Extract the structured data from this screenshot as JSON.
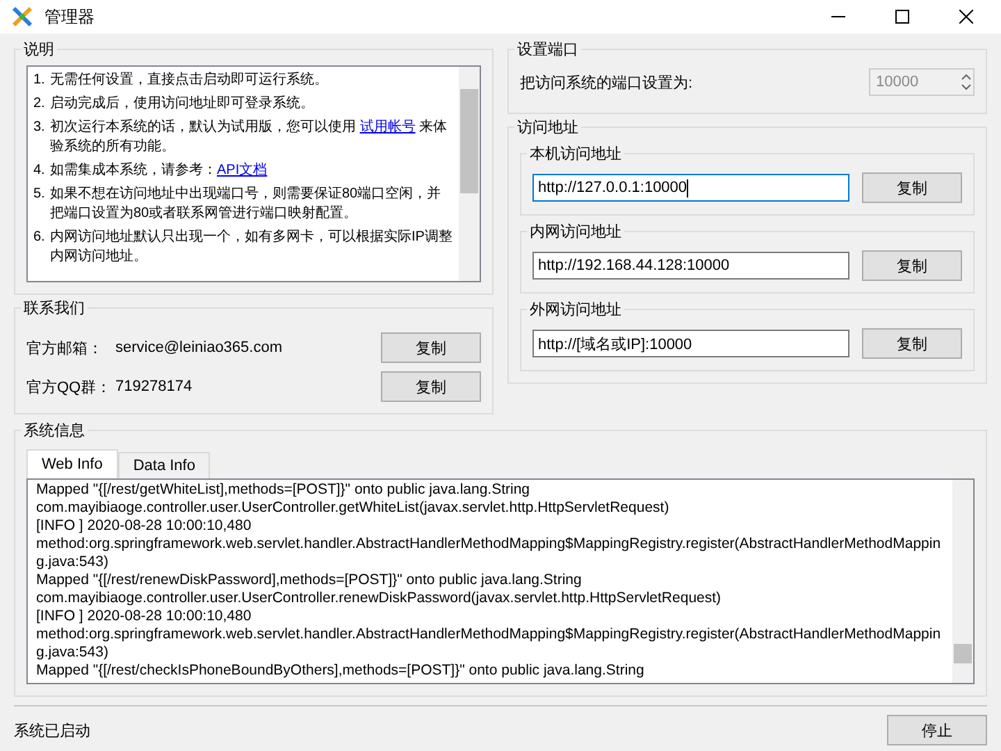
{
  "window": {
    "title": "管理器"
  },
  "instructions": {
    "title": "说明",
    "items": [
      {
        "number": "1.",
        "text": "无需任何设置，直接点击启动即可运行系统。"
      },
      {
        "number": "2.",
        "text": "启动完成后，使用访问地址即可登录系统。"
      },
      {
        "number": "3.",
        "text": "初次运行本系统的话，默认为试用版，您可以使用 ",
        "link": "试用帐号",
        "after": " 来体验系统的所有功能。"
      },
      {
        "number": "4.",
        "text": "如需集成本系统，请参考：",
        "link": "API文档"
      },
      {
        "number": "5.",
        "text": "如果不想在访问地址中出现端口号，则需要保证80端口空闲，并把端口设置为80或者联系网管进行端口映射配置。"
      },
      {
        "number": "6.",
        "text": "内网访问地址默认只出现一个，如有多网卡，可以根据实际IP调整内网访问地址。"
      }
    ]
  },
  "contact": {
    "title": "联系我们",
    "rows": [
      {
        "label": "官方邮箱：",
        "value": "service@leiniao365.com",
        "button": "复制"
      },
      {
        "label": "官方QQ群：",
        "value": "719278174",
        "button": "复制"
      }
    ]
  },
  "port": {
    "title": "设置端口",
    "label": "把访问系统的端口设置为:",
    "value": "10000",
    "disabled": true
  },
  "addresses": {
    "title": "访问地址",
    "groups": [
      {
        "title": "本机访问地址",
        "value": "http://127.0.0.1:10000",
        "focused": true,
        "button": "复制"
      },
      {
        "title": "内网访问地址",
        "value": "http://192.168.44.128:10000",
        "focused": false,
        "button": "复制"
      },
      {
        "title": "外网访问地址",
        "value": "http://[域名或IP]:10000",
        "focused": false,
        "button": "复制"
      }
    ]
  },
  "system_info": {
    "title": "系统信息",
    "tabs": [
      {
        "label": "Web Info",
        "selected": true
      },
      {
        "label": "Data Info",
        "selected": false
      }
    ],
    "log": [
      "Mapped \"{[/rest/getWhiteList],methods=[POST]}\" onto public java.lang.String",
      "com.mayibiaoge.controller.user.UserController.getWhiteList(javax.servlet.http.HttpServletRequest)",
      "[INFO ] 2020-08-28 10:00:10,480",
      "method:org.springframework.web.servlet.handler.AbstractHandlerMethodMapping$MappingRegistry.register(AbstractHandlerMethodMapping.java:543)",
      "Mapped \"{[/rest/renewDiskPassword],methods=[POST]}\" onto public java.lang.String",
      "com.mayibiaoge.controller.user.UserController.renewDiskPassword(javax.servlet.http.HttpServletRequest)",
      "[INFO ] 2020-08-28 10:00:10,480",
      "method:org.springframework.web.servlet.handler.AbstractHandlerMethodMapping$MappingRegistry.register(AbstractHandlerMethodMapping.java:543)",
      "Mapped \"{[/rest/checkIsPhoneBoundByOthers],methods=[POST]}\" onto public java.lang.String"
    ]
  },
  "status_bar": {
    "text": "系统已启动",
    "button": "停止"
  }
}
